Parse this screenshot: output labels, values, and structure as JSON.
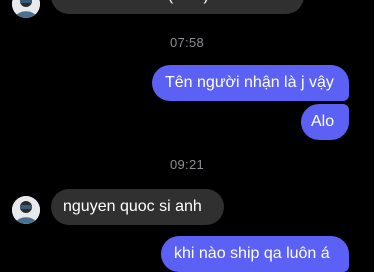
{
  "conversation": {
    "messages": [
      {
        "direction": "incoming",
        "text": "maritime bank (msb)"
      },
      {
        "type": "timestamp",
        "text": "07:58"
      },
      {
        "direction": "outgoing",
        "text": "Tên người nhận là j vậy"
      },
      {
        "direction": "outgoing",
        "text": "Alo"
      },
      {
        "type": "timestamp",
        "text": "09:21"
      },
      {
        "direction": "incoming",
        "text": "nguyen quoc si anh"
      },
      {
        "direction": "outgoing",
        "text": "khi nào ship qa luôn á"
      }
    ]
  },
  "contact": {
    "avatar_icon": "contact-avatar"
  },
  "colors": {
    "background": "#000000",
    "incoming_bubble": "#303030",
    "outgoing_bubble": "#5B61F4",
    "timestamp_text": "#8e8e93"
  }
}
